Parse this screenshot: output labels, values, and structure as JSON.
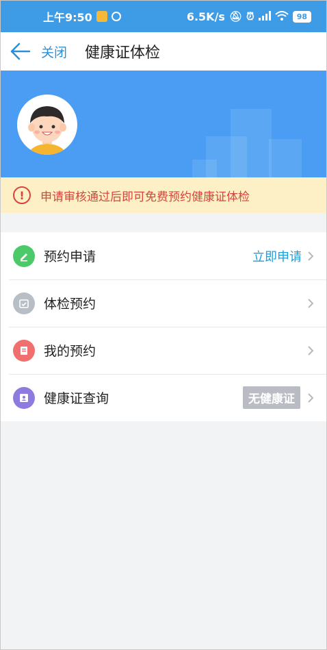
{
  "status_bar": {
    "time": "上午9:50",
    "network_speed": "6.5K/s",
    "battery": "98",
    "icons": [
      "mute-icon",
      "alarm-icon",
      "signal-icon",
      "wifi-icon",
      "battery-icon"
    ]
  },
  "nav": {
    "back_icon": "arrow-left-icon",
    "close_label": "关闭",
    "title": "健康证体检"
  },
  "notice": {
    "icon": "alert-circle-icon",
    "text": "申请审核通过后即可免费预约健康证体检"
  },
  "menu": {
    "items": [
      {
        "label": "预约申请",
        "value": "立即申请",
        "icon": "edit-icon",
        "icon_color": "#4cca6a"
      },
      {
        "label": "体检预约",
        "value": "",
        "icon": "calendar-icon",
        "icon_color": "#b8bec6"
      },
      {
        "label": "我的预约",
        "value": "",
        "icon": "document-icon",
        "icon_color": "#f07070"
      },
      {
        "label": "健康证查询",
        "badge": "无健康证",
        "icon": "id-card-icon",
        "icon_color": "#8f7be0"
      }
    ]
  },
  "colors": {
    "status_bar": "#3e9be6",
    "banner": "#4a9df2",
    "accent": "#2d8fd6",
    "notice_bg": "#fdf0c6",
    "notice_text": "#d9443a"
  }
}
